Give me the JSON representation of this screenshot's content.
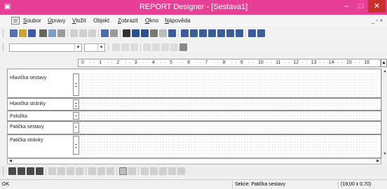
{
  "window": {
    "title": "REPORT Designer - [Sestava1]",
    "app_icon": "report-designer-icon",
    "controls": [
      "minimize-icon",
      "maximize-icon",
      "close-icon"
    ]
  },
  "menubar": {
    "items": [
      {
        "label": "Soubor",
        "mnemonic": "S"
      },
      {
        "label": "Úpravy",
        "mnemonic": "Ú"
      },
      {
        "label": "Vložit",
        "mnemonic": "V"
      },
      {
        "label": "Objekt",
        "mnemonic": "j"
      },
      {
        "label": "Zobrazit",
        "mnemonic": "Z"
      },
      {
        "label": "Okno",
        "mnemonic": "O"
      },
      {
        "label": "Nápověda",
        "mnemonic": "N"
      }
    ],
    "mdi_controls": "_ ▫ ×"
  },
  "ruler": {
    "labels": [
      "0",
      "1",
      "2",
      "3",
      "4",
      "5",
      "6",
      "7",
      "8",
      "9",
      "10",
      "11",
      "12",
      "13",
      "14",
      "15",
      "16"
    ]
  },
  "sections": [
    {
      "label": "Hlavička sestavy"
    },
    {
      "label": "Hlavička stránky"
    },
    {
      "label": "Položka"
    },
    {
      "label": "Patička sestavy"
    },
    {
      "label": "Patička stránky"
    }
  ],
  "status": {
    "state": "OK",
    "section": "Sekce: Patička sestavy",
    "size": "(19,00 x 0,70)"
  },
  "colors": {
    "titlebar": "#e83f96",
    "close_button": "#c9302c",
    "grid_dots": "#b9b9b9"
  }
}
